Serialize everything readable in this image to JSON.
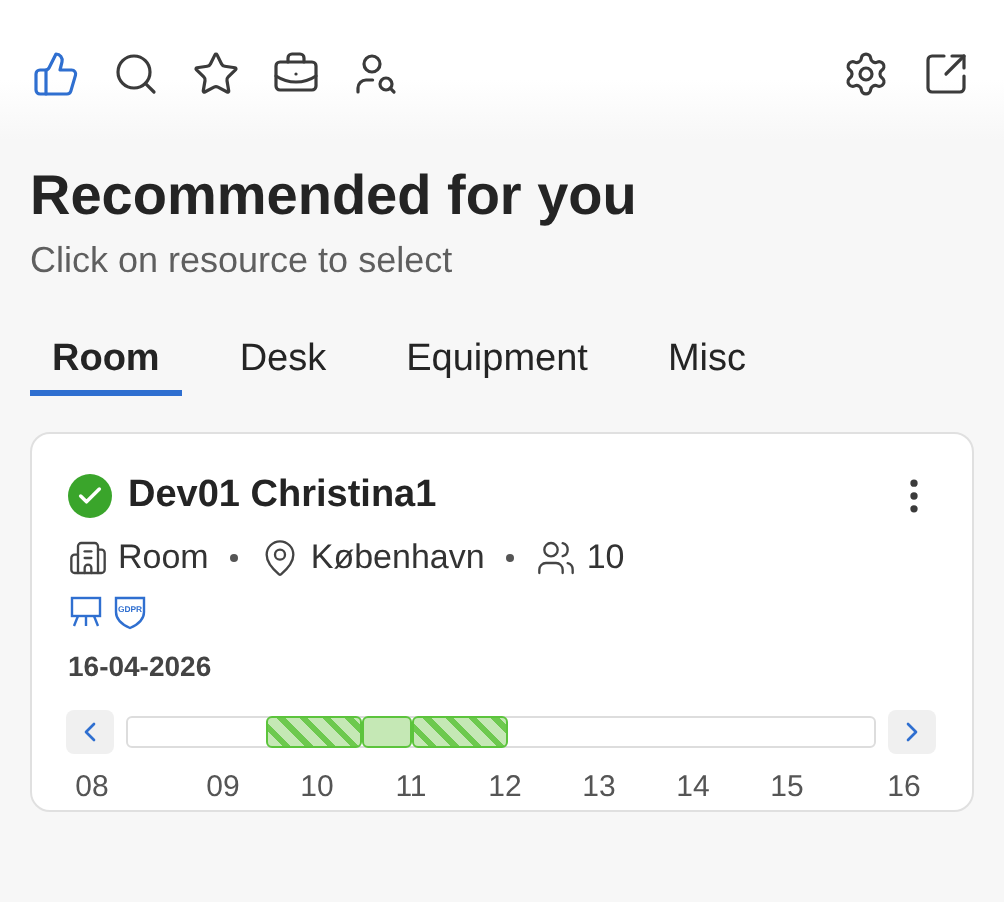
{
  "title": "Recommended for you",
  "subtitle": "Click on resource to select",
  "tabs": [
    {
      "label": "Room",
      "selected": true
    },
    {
      "label": "Desk",
      "selected": false
    },
    {
      "label": "Equipment",
      "selected": false
    },
    {
      "label": "Misc",
      "selected": false
    }
  ],
  "resource": {
    "name": "Dev01 Christina1",
    "available": true,
    "type": "Room",
    "location": "København",
    "capacity": "10",
    "badge": "GDPR",
    "date": "16-04-2026",
    "slots": [
      {
        "kind": "free"
      },
      {
        "kind": "free"
      },
      {
        "kind": "free"
      },
      {
        "kind": "booked"
      },
      {
        "kind": "booked"
      },
      {
        "kind": "selected"
      },
      {
        "kind": "booked"
      },
      {
        "kind": "booked"
      },
      {
        "kind": "free"
      },
      {
        "kind": "free"
      },
      {
        "kind": "free"
      },
      {
        "kind": "free"
      },
      {
        "kind": "free"
      },
      {
        "kind": "free"
      },
      {
        "kind": "free"
      },
      {
        "kind": "free"
      }
    ],
    "hours": [
      "08",
      "09",
      "10",
      "11",
      "12",
      "13",
      "14",
      "15",
      "16"
    ]
  }
}
